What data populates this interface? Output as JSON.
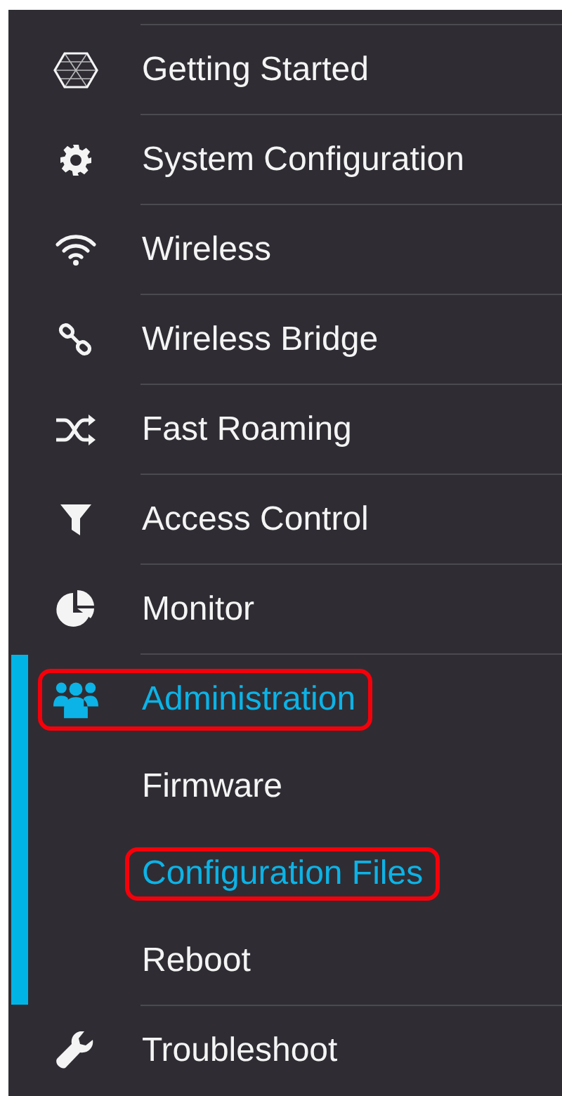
{
  "sidebar": {
    "items": [
      {
        "label": "Getting Started",
        "selected": false,
        "highlighted": false
      },
      {
        "label": "System Configuration",
        "selected": false,
        "highlighted": false
      },
      {
        "label": "Wireless",
        "selected": false,
        "highlighted": false
      },
      {
        "label": "Wireless Bridge",
        "selected": false,
        "highlighted": false
      },
      {
        "label": "Fast Roaming",
        "selected": false,
        "highlighted": false
      },
      {
        "label": "Access Control",
        "selected": false,
        "highlighted": false
      },
      {
        "label": "Monitor",
        "selected": false,
        "highlighted": false
      },
      {
        "label": "Administration",
        "selected": true,
        "highlighted": true,
        "expanded": true,
        "children": [
          {
            "label": "Firmware",
            "selected": false,
            "highlighted": false
          },
          {
            "label": "Configuration Files",
            "selected": true,
            "highlighted": true
          },
          {
            "label": "Reboot",
            "selected": false,
            "highlighted": false
          }
        ]
      },
      {
        "label": "Troubleshoot",
        "selected": false,
        "highlighted": false
      }
    ]
  }
}
